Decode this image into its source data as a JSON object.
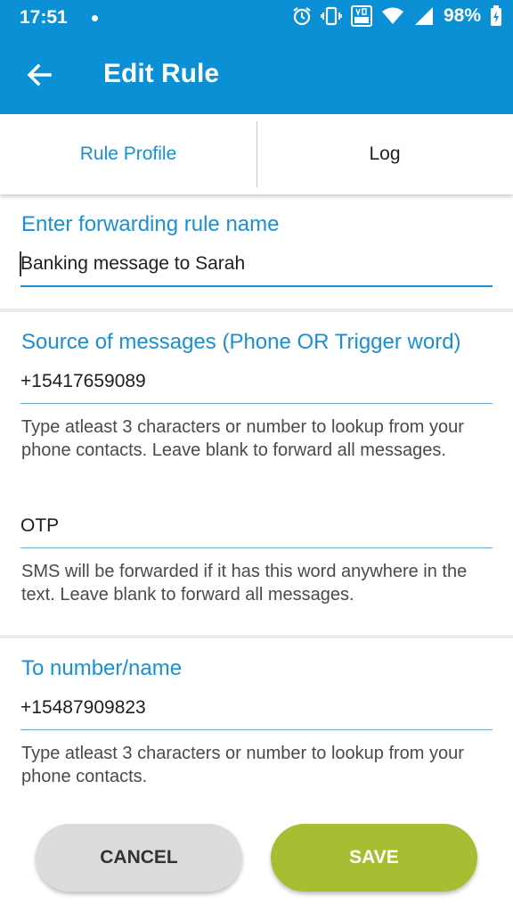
{
  "status_bar": {
    "time": "17:51",
    "battery": "98%",
    "icons": [
      "alarm-icon",
      "vibrate-icon",
      "volte-icon",
      "wifi-icon",
      "signal-icon",
      "battery-icon"
    ]
  },
  "app_bar": {
    "title": "Edit Rule",
    "color": "#0b90d6"
  },
  "tabs": [
    {
      "label": "Rule Profile",
      "active": true
    },
    {
      "label": "Log",
      "active": false
    }
  ],
  "rule_name": {
    "heading": "Enter forwarding rule name",
    "value": "Banking message to Sarah"
  },
  "source": {
    "heading": "Source of messages (Phone OR Trigger word)",
    "phone_value": "+15417659089",
    "phone_hint": "Type atleast 3 characters or number to lookup from your phone contacts. Leave blank to forward all messages.",
    "trigger_value": "OTP",
    "trigger_hint": "SMS will be forwarded if it has this word anywhere in the text. Leave blank to forward all messages."
  },
  "destination": {
    "heading": "To number/name",
    "value": "+15487909823",
    "hint": "Type atleast 3 characters or number to lookup from your phone contacts."
  },
  "actions": {
    "cancel_label": "CANCEL",
    "save_label": "SAVE"
  },
  "colors": {
    "accent": "#1a8fd2",
    "save": "#a9bd32",
    "cancel": "#dcdcdc"
  }
}
